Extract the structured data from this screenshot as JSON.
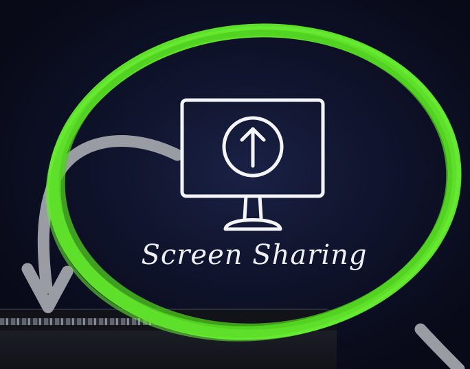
{
  "illustration": {
    "icon": "monitor-upload-icon",
    "caption": "Screen Sharing",
    "highlight_color": "#5ee02a",
    "arrow_color": "#9a9ca4",
    "icon_color": "#f4f5f8"
  },
  "background": {
    "color": "#0a0d1f"
  }
}
